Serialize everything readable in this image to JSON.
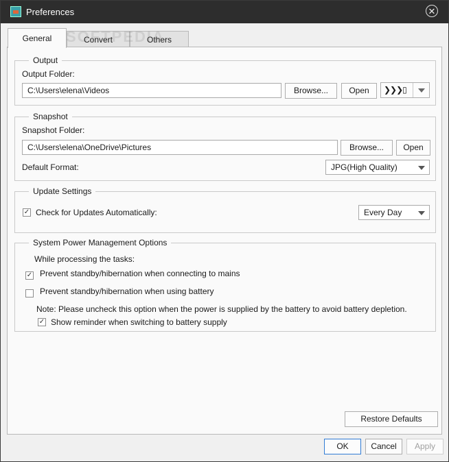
{
  "window": {
    "title": "Preferences"
  },
  "tabs": [
    {
      "label": "General"
    },
    {
      "label": "Convert"
    },
    {
      "label": "Others"
    }
  ],
  "watermark": "SOFTPEDIA",
  "output": {
    "group_title": "Output",
    "folder_label": "Output Folder:",
    "folder_value": "C:\\Users\\elena\\Videos",
    "browse_label": "Browse...",
    "open_label": "Open",
    "device_glyph": "❯❯❯▯"
  },
  "snapshot": {
    "group_title": "Snapshot",
    "folder_label": "Snapshot Folder:",
    "folder_value": "C:\\Users\\elena\\OneDrive\\Pictures",
    "browse_label": "Browse...",
    "open_label": "Open",
    "format_label": "Default Format:",
    "format_value": "JPG(High Quality)"
  },
  "update": {
    "group_title": "Update Settings",
    "check_label": "Check for Updates Automatically:",
    "checked": true,
    "frequency_value": "Every Day"
  },
  "power": {
    "group_title": "System Power Management Options",
    "intro": "While processing the tasks:",
    "opt_mains": "Prevent standby/hibernation when connecting to mains",
    "opt_mains_checked": true,
    "opt_battery": "Prevent standby/hibernation when using battery",
    "opt_battery_checked": false,
    "note": "Note: Please uncheck this option when the power is supplied by the battery to avoid battery depletion.",
    "reminder": "Show reminder when switching to battery supply",
    "reminder_checked": true
  },
  "buttons": {
    "restore": "Restore Defaults",
    "ok": "OK",
    "cancel": "Cancel",
    "apply": "Apply"
  },
  "icons": {
    "check": "✓",
    "close": "✕"
  }
}
